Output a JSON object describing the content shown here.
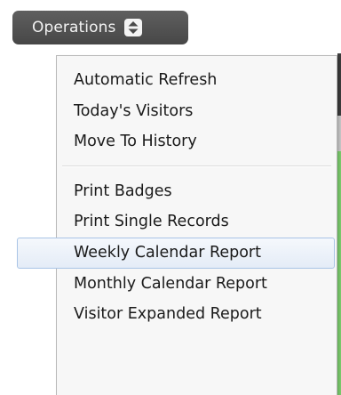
{
  "operations_button": {
    "label": "Operations",
    "icon": "updown-arrows-icon"
  },
  "menu": {
    "group_1": [
      {
        "label": "Automatic Refresh"
      },
      {
        "label": "Today's Visitors"
      },
      {
        "label": "Move To History"
      }
    ],
    "group_2": [
      {
        "label": "Print Badges"
      },
      {
        "label": "Print Single Records"
      },
      {
        "label": "Weekly Calendar Report",
        "highlighted": true
      },
      {
        "label": "Monthly Calendar Report"
      },
      {
        "label": "Visitor Expanded Report"
      }
    ]
  },
  "colors": {
    "button_bg": "#474747",
    "highlight_border": "#a9c4e6",
    "highlight_bg": "#e4ecf7"
  }
}
